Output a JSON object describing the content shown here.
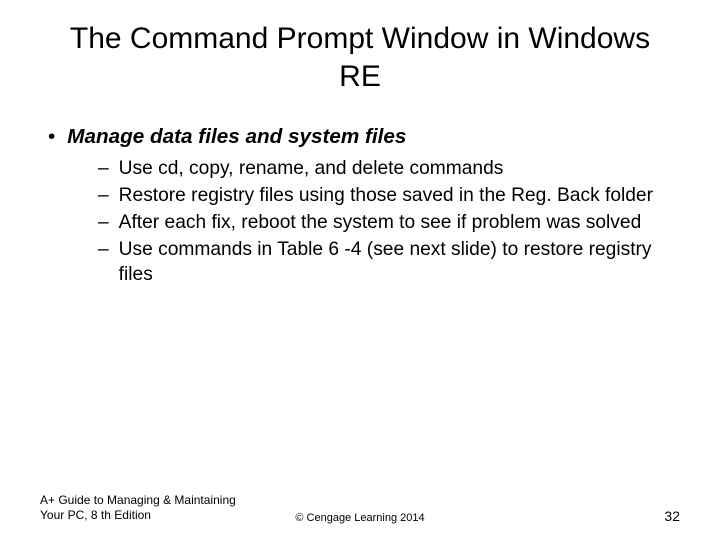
{
  "title": "The Command Prompt Window in Windows RE",
  "main_bullet": {
    "marker": "•",
    "text": "Manage data files and system files"
  },
  "sub_bullets": [
    {
      "marker": "–",
      "text": "Use cd, copy, rename, and delete commands"
    },
    {
      "marker": "–",
      "text": "Restore registry files using those saved in the Reg. Back folder"
    },
    {
      "marker": "–",
      "text": "After each fix, reboot the system to see if problem was solved"
    },
    {
      "marker": "–",
      "text": "Use commands in Table 6 -4 (see next slide) to restore registry files"
    }
  ],
  "footer": {
    "left": "A+ Guide to Managing & Maintaining Your PC, 8 th Edition",
    "center": "© Cengage Learning  2014",
    "right": "32"
  }
}
